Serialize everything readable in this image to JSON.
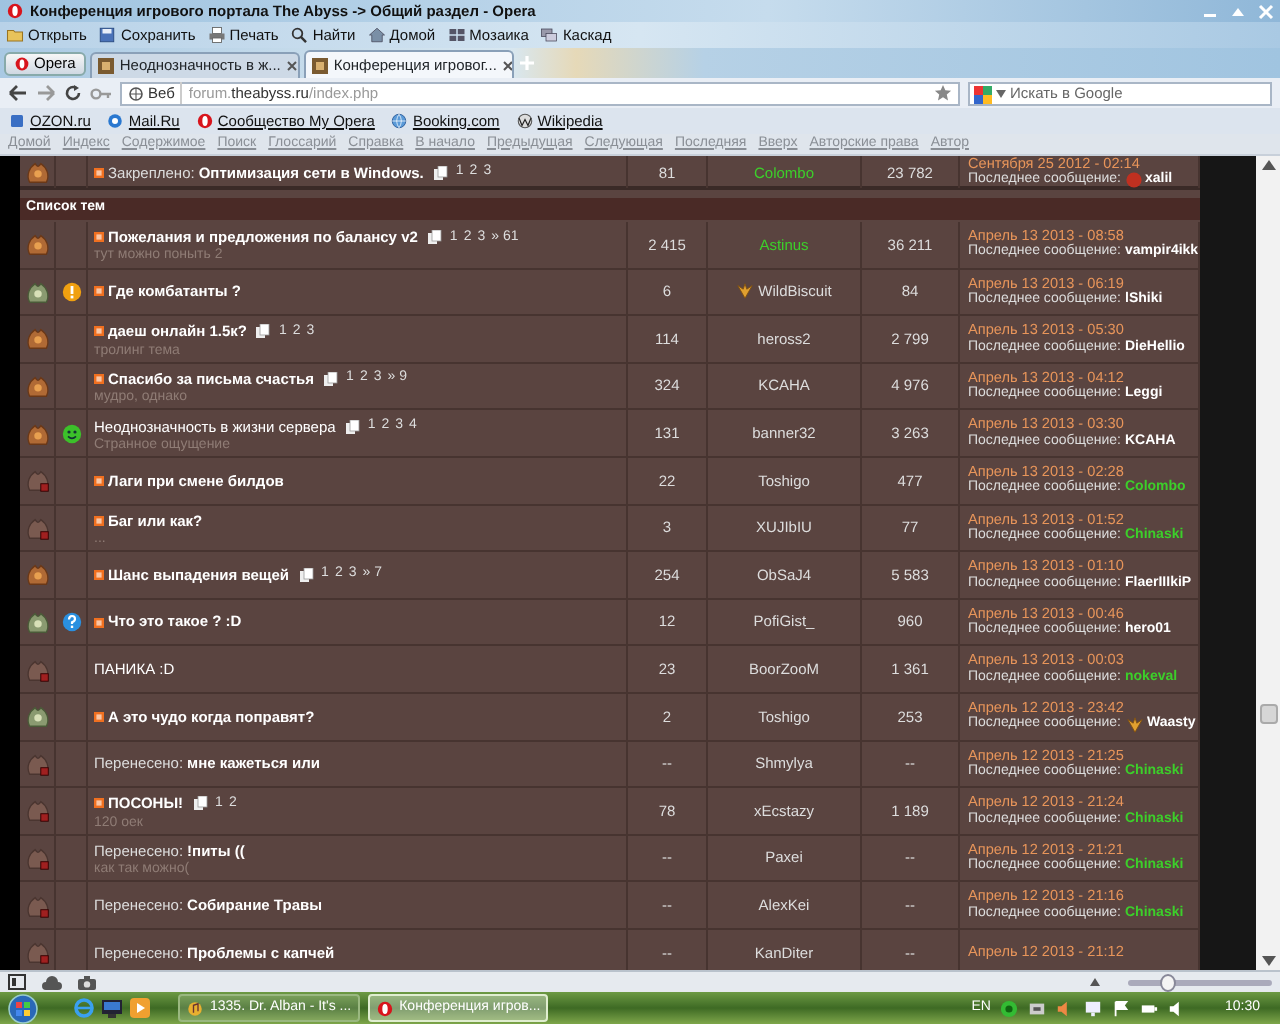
{
  "window": {
    "title": "Конференция игрового портала The Abyss -> Общий раздел - Opera"
  },
  "toolbar": [
    {
      "label": "Открыть",
      "kind": "folder"
    },
    {
      "label": "Сохранить",
      "kind": "disk"
    },
    {
      "label": "Печать",
      "kind": "printer"
    },
    {
      "label": "Найти",
      "kind": "search"
    },
    {
      "label": "Домой",
      "kind": "house"
    },
    {
      "label": "Мозаика",
      "kind": "grid"
    },
    {
      "label": "Каскад",
      "kind": "windows"
    }
  ],
  "opera_button": {
    "label": "Opera"
  },
  "tabs": [
    {
      "label": "Неоднозначность в ж...",
      "selected": false
    },
    {
      "label": "Конференция игровог...",
      "selected": true
    }
  ],
  "address": {
    "badge": "Веб",
    "url_start": "forum.",
    "url_domain": "theabyss.ru",
    "url_end": "/index.php"
  },
  "search": {
    "placeholder": "Искать в Google"
  },
  "bookmarks": [
    {
      "label": "OZON.ru",
      "kind": "square"
    },
    {
      "label": "Mail.Ru",
      "kind": "at"
    },
    {
      "label": "Сообщество My Opera",
      "kind": "opera"
    },
    {
      "label": "Booking.com",
      "kind": "globe"
    },
    {
      "label": "Wikipedia",
      "kind": "wiki"
    }
  ],
  "nav_links": [
    "Домой",
    "Индекс",
    "Содержимое",
    "Поиск",
    "Глоссарий",
    "Справка",
    "В начало",
    "Предыдущая",
    "Следующая",
    "Последняя",
    "Вверх",
    "Авторские права",
    "Автор"
  ],
  "forum": {
    "pinned": [
      {
        "kind": "hot",
        "unread": true,
        "prefix": "Закреплено:",
        "title": "Оптимизация сети в Windows.",
        "pages": [
          "1",
          "2",
          "3"
        ],
        "replies": "81",
        "author": {
          "name": "Colombo",
          "color": "#3ccf2a"
        },
        "views": "23 782",
        "date": "Сентября 25 2012 - 02:14",
        "last_label": "Последнее сообщение:",
        "last_by": {
          "name": "xalil",
          "kind": "avatar"
        }
      }
    ],
    "section_title": "Список тем",
    "topics": [
      {
        "kind": "hot",
        "unread": true,
        "title": "Пожелания и предложения по балансу v2",
        "pages": [
          "1",
          "2",
          "3",
          "» 61"
        ],
        "subtitle": "тут можно поныть 2",
        "replies": "2 415",
        "author": {
          "name": "Astinus",
          "color": "#3ccf2a"
        },
        "views": "36 211",
        "date": "Апрель 13 2013 - 08:58",
        "last_label": "Последнее сообщение:",
        "last_by": {
          "name": "vampir4ikk"
        }
      },
      {
        "kind": "dot",
        "marker": {
          "kind": "warning"
        },
        "unread": true,
        "title": "Где комбатанты ?",
        "replies": "6",
        "author": {
          "name": "WildBiscuit",
          "kind": "wings"
        },
        "views": "84",
        "date": "Апрель 13 2013 - 06:19",
        "last_label": "Последнее сообщение:",
        "last_by": {
          "name": "lShiki"
        }
      },
      {
        "kind": "hot",
        "unread": true,
        "title": "даеш онлайн 1.5к?",
        "pages": [
          "1",
          "2",
          "3"
        ],
        "subtitle": "тролинг тема",
        "replies": "114",
        "author": {
          "name": "heross2"
        },
        "views": "2 799",
        "date": "Апрель 13 2013 - 05:30",
        "last_label": "Последнее сообщение:",
        "last_by": {
          "name": "DieHellio"
        }
      },
      {
        "kind": "hot",
        "unread": true,
        "title": "Спасибо за письма счастья",
        "pages": [
          "1",
          "2",
          "3",
          "» 9"
        ],
        "subtitle": "мудро, однако",
        "replies": "324",
        "author": {
          "name": "KCAHA"
        },
        "views": "4 976",
        "date": "Апрель 13 2013 - 04:12",
        "last_label": "Последнее сообщение:",
        "last_by": {
          "name": "Leggi"
        }
      },
      {
        "kind": "hot",
        "marker": {
          "kind": "smile"
        },
        "unread": false,
        "title": "Неоднозначность в жизни сервера",
        "pages": [
          "1",
          "2",
          "3",
          "4"
        ],
        "subtitle": "Странное ощущение",
        "replies": "131",
        "author": {
          "name": "banner32"
        },
        "views": "3 263",
        "date": "Апрель 13 2013 - 03:30",
        "last_label": "Последнее сообщение:",
        "last_by": {
          "name": "KCAHA"
        }
      },
      {
        "kind": "closed",
        "unread": true,
        "title": "Лаги при смене билдов",
        "replies": "22",
        "author": {
          "name": "Toshigo"
        },
        "views": "477",
        "date": "Апрель 13 2013 - 02:28",
        "last_label": "Последнее сообщение:",
        "last_by": {
          "name": "Colombo",
          "color": "#3ccf2a"
        }
      },
      {
        "kind": "closed",
        "unread": true,
        "title": "Баг или как?",
        "subtitle": "...",
        "replies": "3",
        "author": {
          "name": "XUJIbIU"
        },
        "views": "77",
        "date": "Апрель 13 2013 - 01:52",
        "last_label": "Последнее сообщение:",
        "last_by": {
          "name": "Chinaski",
          "color": "#3ccf2a"
        }
      },
      {
        "kind": "hot",
        "unread": true,
        "title": "Шанс выпадения вещей",
        "pages": [
          "1",
          "2",
          "3",
          "» 7"
        ],
        "replies": "254",
        "author": {
          "name": "ObSaJ4"
        },
        "views": "5 583",
        "date": "Апрель 13 2013 - 01:10",
        "last_label": "Последнее сообщение:",
        "last_by": {
          "name": "FlaerIIIkiP"
        }
      },
      {
        "kind": "dot",
        "marker": {
          "kind": "question"
        },
        "unread": true,
        "title": "Что это такое ? :D",
        "replies": "12",
        "author": {
          "name": "PofiGist_"
        },
        "views": "960",
        "date": "Апрель 13 2013 - 00:46",
        "last_label": "Последнее сообщение:",
        "last_by": {
          "name": "hero01"
        }
      },
      {
        "kind": "closed",
        "unread": false,
        "title": "ПАНИКА :D",
        "replies": "23",
        "author": {
          "name": "BoorZooM"
        },
        "views": "1 361",
        "date": "Апрель 13 2013 - 00:03",
        "last_label": "Последнее сообщение:",
        "last_by": {
          "name": "nokeval",
          "color": "#3ccf2a"
        }
      },
      {
        "kind": "dot",
        "unread": true,
        "title": "А это чудо когда поправят?",
        "replies": "2",
        "author": {
          "name": "Toshigo"
        },
        "views": "253",
        "date": "Апрель 12 2013 - 23:42",
        "last_label": "Последнее сообщение:",
        "last_by": {
          "name": "Waasty",
          "kind": "wings"
        }
      },
      {
        "kind": "closed",
        "unread": false,
        "prefix": "Перенесено:",
        "title": "мне кажеться или",
        "replies": "--",
        "author": {
          "name": "Shmylya"
        },
        "views": "--",
        "date": "Апрель 12 2013 - 21:25",
        "last_label": "Последнее сообщение:",
        "last_by": {
          "name": "Chinaski",
          "color": "#3ccf2a"
        }
      },
      {
        "kind": "closed",
        "unread": true,
        "title": "ПОСОНЫ!",
        "pages": [
          "1",
          "2"
        ],
        "subtitle": "120 оек",
        "replies": "78",
        "author": {
          "name": "xEcstazy"
        },
        "views": "1 189",
        "date": "Апрель 12 2013 - 21:24",
        "last_label": "Последнее сообщение:",
        "last_by": {
          "name": "Chinaski",
          "color": "#3ccf2a"
        }
      },
      {
        "kind": "closed",
        "unread": false,
        "prefix": "Перенесено:",
        "title": "!питы ((",
        "subtitle": "как так можно(",
        "replies": "--",
        "author": {
          "name": "Paxei"
        },
        "views": "--",
        "date": "Апрель 12 2013 - 21:21",
        "last_label": "Последнее сообщение:",
        "last_by": {
          "name": "Chinaski",
          "color": "#3ccf2a"
        }
      },
      {
        "kind": "closed",
        "unread": false,
        "prefix": "Перенесено:",
        "title": "Собирание Травы",
        "replies": "--",
        "author": {
          "name": "AlexKei"
        },
        "views": "--",
        "date": "Апрель 12 2013 - 21:16",
        "last_label": "Последнее сообщение:",
        "last_by": {
          "name": "Chinaski",
          "color": "#3ccf2a"
        }
      },
      {
        "kind": "closed",
        "unread": false,
        "prefix": "Перенесено:",
        "title": "Проблемы с капчей",
        "replies": "--",
        "author": {
          "name": "KanDiter"
        },
        "views": "--",
        "date": "Апрель 12 2013 - 21:12"
      }
    ]
  },
  "status_bar": {
    "zoom": {
      "level": 0.28
    }
  },
  "taskbar": {
    "tasks": [
      {
        "label": "1335. Dr. Alban - It's ...",
        "kind": "music",
        "selected": false
      },
      {
        "label": "Конференция игров...",
        "kind": "opera",
        "selected": true
      }
    ],
    "language": "EN",
    "clock": "10:30"
  }
}
